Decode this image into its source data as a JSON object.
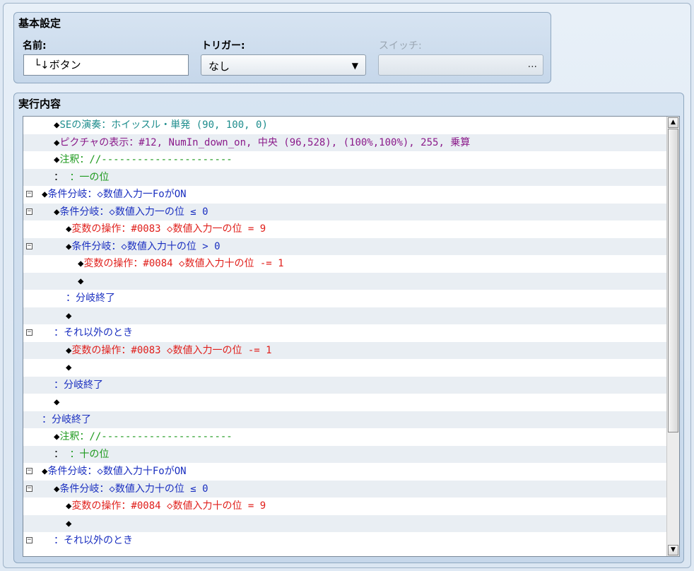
{
  "basic_settings": {
    "title": "基本設定",
    "name_label": "名前:",
    "name_value": "└↓ボタン",
    "trigger_label": "トリガー:",
    "trigger_value": "なし",
    "switch_label": "スイッチ:",
    "switch_button": "..."
  },
  "contents": {
    "title": "実行内容",
    "rows": [
      {
        "indent": 1,
        "fold": false,
        "parts": [
          [
            "diamond",
            "◆"
          ],
          [
            "teal",
            "SEの演奏：ホイッスル・単発 (90, 100, 0)"
          ]
        ]
      },
      {
        "indent": 1,
        "fold": false,
        "parts": [
          [
            "diamond",
            "◆"
          ],
          [
            "purple",
            "ピクチャの表示：#12, NumIn_down_on, 中央 (96,528), (100%,100%), 255, 乗算"
          ]
        ]
      },
      {
        "indent": 1,
        "fold": false,
        "parts": [
          [
            "diamond",
            "◆"
          ],
          [
            "green",
            "注釈：//----------------------"
          ]
        ]
      },
      {
        "indent": 1,
        "fold": false,
        "parts": [
          [
            "black",
            "：      "
          ],
          [
            "green",
            "：一の位"
          ]
        ]
      },
      {
        "indent": 0,
        "fold": true,
        "parts": [
          [
            "diamond",
            "◆"
          ],
          [
            "blue",
            "条件分岐：◇数値入力一FoがON"
          ]
        ]
      },
      {
        "indent": 1,
        "fold": true,
        "parts": [
          [
            "diamond",
            "◆"
          ],
          [
            "blue",
            "条件分岐：◇数値入力一の位 ≤ 0"
          ]
        ]
      },
      {
        "indent": 2,
        "fold": false,
        "parts": [
          [
            "diamond",
            "◆"
          ],
          [
            "red",
            "変数の操作：#0083 ◇数値入力一の位 = 9"
          ]
        ]
      },
      {
        "indent": 2,
        "fold": true,
        "parts": [
          [
            "diamond",
            "◆"
          ],
          [
            "blue",
            "条件分岐：◇数値入力十の位 > 0"
          ]
        ]
      },
      {
        "indent": 3,
        "fold": false,
        "parts": [
          [
            "diamond",
            "◆"
          ],
          [
            "red",
            "変数の操作：#0084 ◇数値入力十の位 -= 1"
          ]
        ]
      },
      {
        "indent": 3,
        "fold": false,
        "parts": [
          [
            "diamond",
            "◆"
          ]
        ]
      },
      {
        "indent": 2,
        "fold": false,
        "parts": [
          [
            "blue",
            "：分岐終了"
          ]
        ]
      },
      {
        "indent": 2,
        "fold": false,
        "parts": [
          [
            "diamond",
            "◆"
          ]
        ]
      },
      {
        "indent": 1,
        "fold": true,
        "parts": [
          [
            "blue",
            "：それ以外のとき"
          ]
        ]
      },
      {
        "indent": 2,
        "fold": false,
        "parts": [
          [
            "diamond",
            "◆"
          ],
          [
            "red",
            "変数の操作：#0083 ◇数値入力一の位 -= 1"
          ]
        ]
      },
      {
        "indent": 2,
        "fold": false,
        "parts": [
          [
            "diamond",
            "◆"
          ]
        ]
      },
      {
        "indent": 1,
        "fold": false,
        "parts": [
          [
            "blue",
            "：分岐終了"
          ]
        ]
      },
      {
        "indent": 1,
        "fold": false,
        "parts": [
          [
            "diamond",
            "◆"
          ]
        ]
      },
      {
        "indent": 0,
        "fold": false,
        "parts": [
          [
            "blue",
            "：分岐終了"
          ]
        ]
      },
      {
        "indent": 1,
        "fold": false,
        "parts": [
          [
            "diamond",
            "◆"
          ],
          [
            "green",
            "注釈：//----------------------"
          ]
        ]
      },
      {
        "indent": 1,
        "fold": false,
        "parts": [
          [
            "black",
            "：      "
          ],
          [
            "green",
            "：十の位"
          ]
        ]
      },
      {
        "indent": 0,
        "fold": true,
        "parts": [
          [
            "diamond",
            "◆"
          ],
          [
            "blue",
            "条件分岐：◇数値入力十FoがON"
          ]
        ]
      },
      {
        "indent": 1,
        "fold": true,
        "parts": [
          [
            "diamond",
            "◆"
          ],
          [
            "blue",
            "条件分岐：◇数値入力十の位 ≤ 0"
          ]
        ]
      },
      {
        "indent": 2,
        "fold": false,
        "parts": [
          [
            "diamond",
            "◆"
          ],
          [
            "red",
            "変数の操作：#0084 ◇数値入力十の位 = 9"
          ]
        ]
      },
      {
        "indent": 2,
        "fold": false,
        "parts": [
          [
            "diamond",
            "◆"
          ]
        ]
      },
      {
        "indent": 1,
        "fold": true,
        "parts": [
          [
            "blue",
            "：それ以外のとき"
          ]
        ]
      }
    ]
  },
  "scrollbar": {
    "up_arrow": "▲",
    "down_arrow": "▼"
  },
  "icons": {
    "fold": "⊟",
    "dropdown": "▼"
  },
  "colors": {
    "blue": "#1a2fc0",
    "red": "#e0201c",
    "teal": "#1e8d8d",
    "purple": "#8a1a8a",
    "green": "#1e9a1e"
  }
}
